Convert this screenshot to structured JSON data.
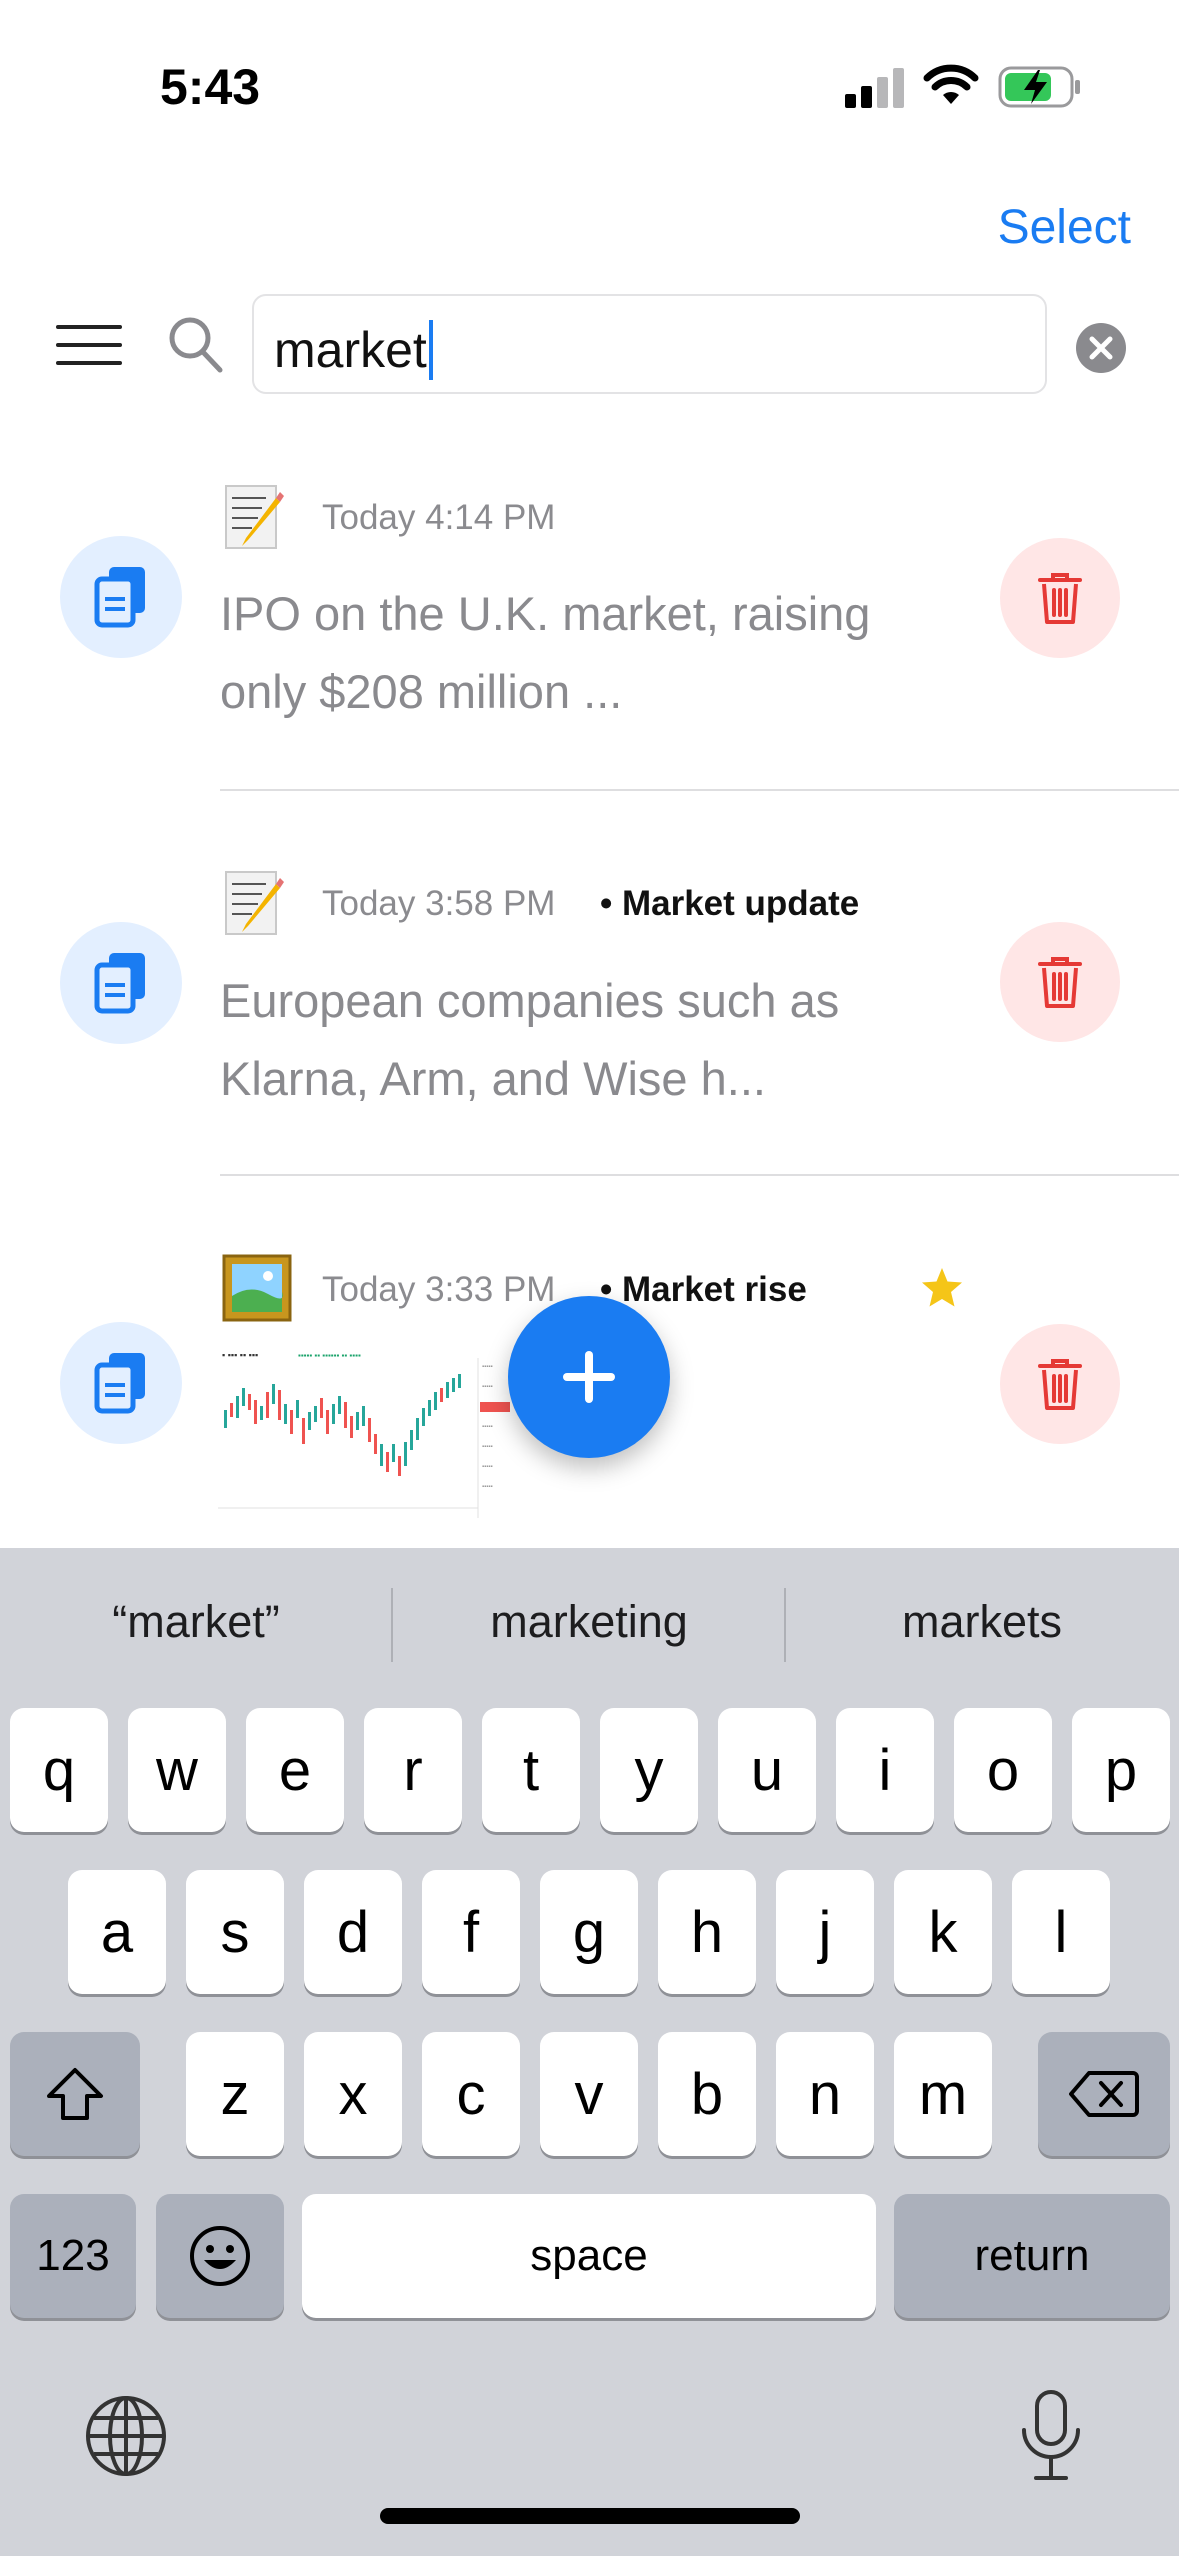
{
  "status_bar": {
    "time": "5:43",
    "icons": [
      "cellular-signal-icon",
      "wifi-icon",
      "battery-charging-icon"
    ]
  },
  "header": {
    "select_label": "Select"
  },
  "search": {
    "query": "market"
  },
  "items": [
    {
      "time": "Today 4:14 PM",
      "tag": "",
      "preview": "IPO on the U.K. market, raising only $208 million ...",
      "icon": "note-pencil-icon",
      "starred": false
    },
    {
      "time": "Today 3:58 PM",
      "tag": "• Market update",
      "preview": "European companies such as Klarna, Arm, and Wise h...",
      "icon": "note-pencil-icon",
      "starred": false
    },
    {
      "time": "Today 3:33 PM",
      "tag": "• Market rise",
      "preview": "",
      "icon": "framed-picture-icon",
      "starred": true
    }
  ],
  "keyboard": {
    "suggestions": [
      "“market”",
      "marketing",
      "markets"
    ],
    "row1": [
      "q",
      "w",
      "e",
      "r",
      "t",
      "y",
      "u",
      "i",
      "o",
      "p"
    ],
    "row2": [
      "a",
      "s",
      "d",
      "f",
      "g",
      "h",
      "j",
      "k",
      "l"
    ],
    "row3": [
      "z",
      "x",
      "c",
      "v",
      "b",
      "n",
      "m"
    ],
    "numbers_label": "123",
    "space_label": "space",
    "return_label": "return"
  },
  "colors": {
    "accent": "#1a7cf2",
    "delete": "#e53935",
    "star": "#f5c518"
  }
}
